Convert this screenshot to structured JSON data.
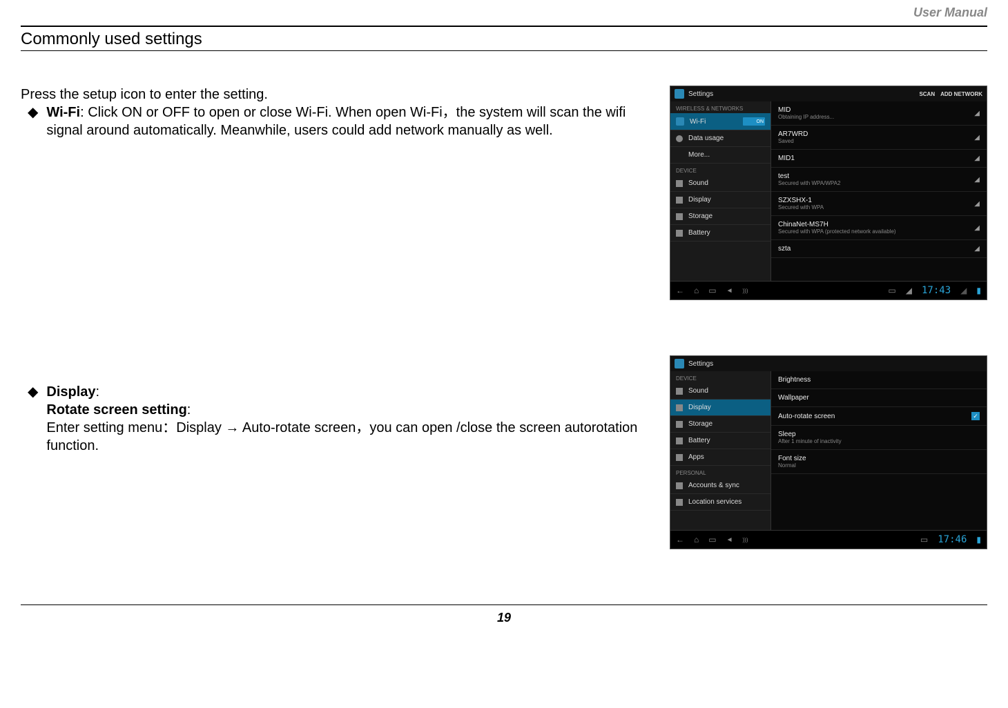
{
  "header": {
    "doc_label": "User Manual"
  },
  "section_title": "Commonly used settings",
  "wifi_section": {
    "intro": "Press the setup icon to enter the setting.",
    "label": "Wi-Fi",
    "text": ": Click ON or OFF to open or close Wi-Fi. When open Wi-Fi，the system will scan the wifi signal around automatically. Meanwhile, users could add network manually as well."
  },
  "display_section": {
    "label": "Display",
    "sub_label": "Rotate screen setting",
    "text": "Enter setting menu：Display → Auto-rotate screen，you can open /close the screen autorotation function."
  },
  "page_number": "19",
  "screenshot1": {
    "app_title": "Settings",
    "actions": [
      "SCAN",
      "ADD NETWORK"
    ],
    "sidebar": {
      "sections": [
        {
          "label": "WIRELESS & NETWORKS",
          "items": [
            {
              "name": "Wi-Fi",
              "active": true,
              "toggle": "ON"
            },
            {
              "name": "Data usage"
            },
            {
              "name": "More..."
            }
          ]
        },
        {
          "label": "DEVICE",
          "items": [
            {
              "name": "Sound"
            },
            {
              "name": "Display"
            },
            {
              "name": "Storage"
            },
            {
              "name": "Battery"
            }
          ]
        }
      ]
    },
    "networks": [
      {
        "name": "MID",
        "sub": "Obtaining IP address..."
      },
      {
        "name": "AR7WRD",
        "sub": "Saved"
      },
      {
        "name": "MID1",
        "sub": ""
      },
      {
        "name": "test",
        "sub": "Secured with WPA/WPA2"
      },
      {
        "name": "SZXSHX-1",
        "sub": "Secured with WPA"
      },
      {
        "name": "ChinaNet-MS7H",
        "sub": "Secured with WPA (protected network available)"
      },
      {
        "name": "szta",
        "sub": ""
      }
    ],
    "time": "17:43"
  },
  "screenshot2": {
    "app_title": "Settings",
    "sidebar": {
      "sections": [
        {
          "label": "DEVICE",
          "items": [
            {
              "name": "Sound"
            },
            {
              "name": "Display",
              "active": true
            },
            {
              "name": "Storage"
            },
            {
              "name": "Battery"
            },
            {
              "name": "Apps"
            }
          ]
        },
        {
          "label": "PERSONAL",
          "items": [
            {
              "name": "Accounts & sync"
            },
            {
              "name": "Location services"
            }
          ]
        }
      ]
    },
    "options": [
      {
        "name": "Brightness"
      },
      {
        "name": "Wallpaper"
      },
      {
        "name": "Auto-rotate screen",
        "checked": true
      },
      {
        "name": "Sleep",
        "sub": "After 1 minute of inactivity"
      },
      {
        "name": "Font size",
        "sub": "Normal"
      }
    ],
    "time": "17:46"
  }
}
